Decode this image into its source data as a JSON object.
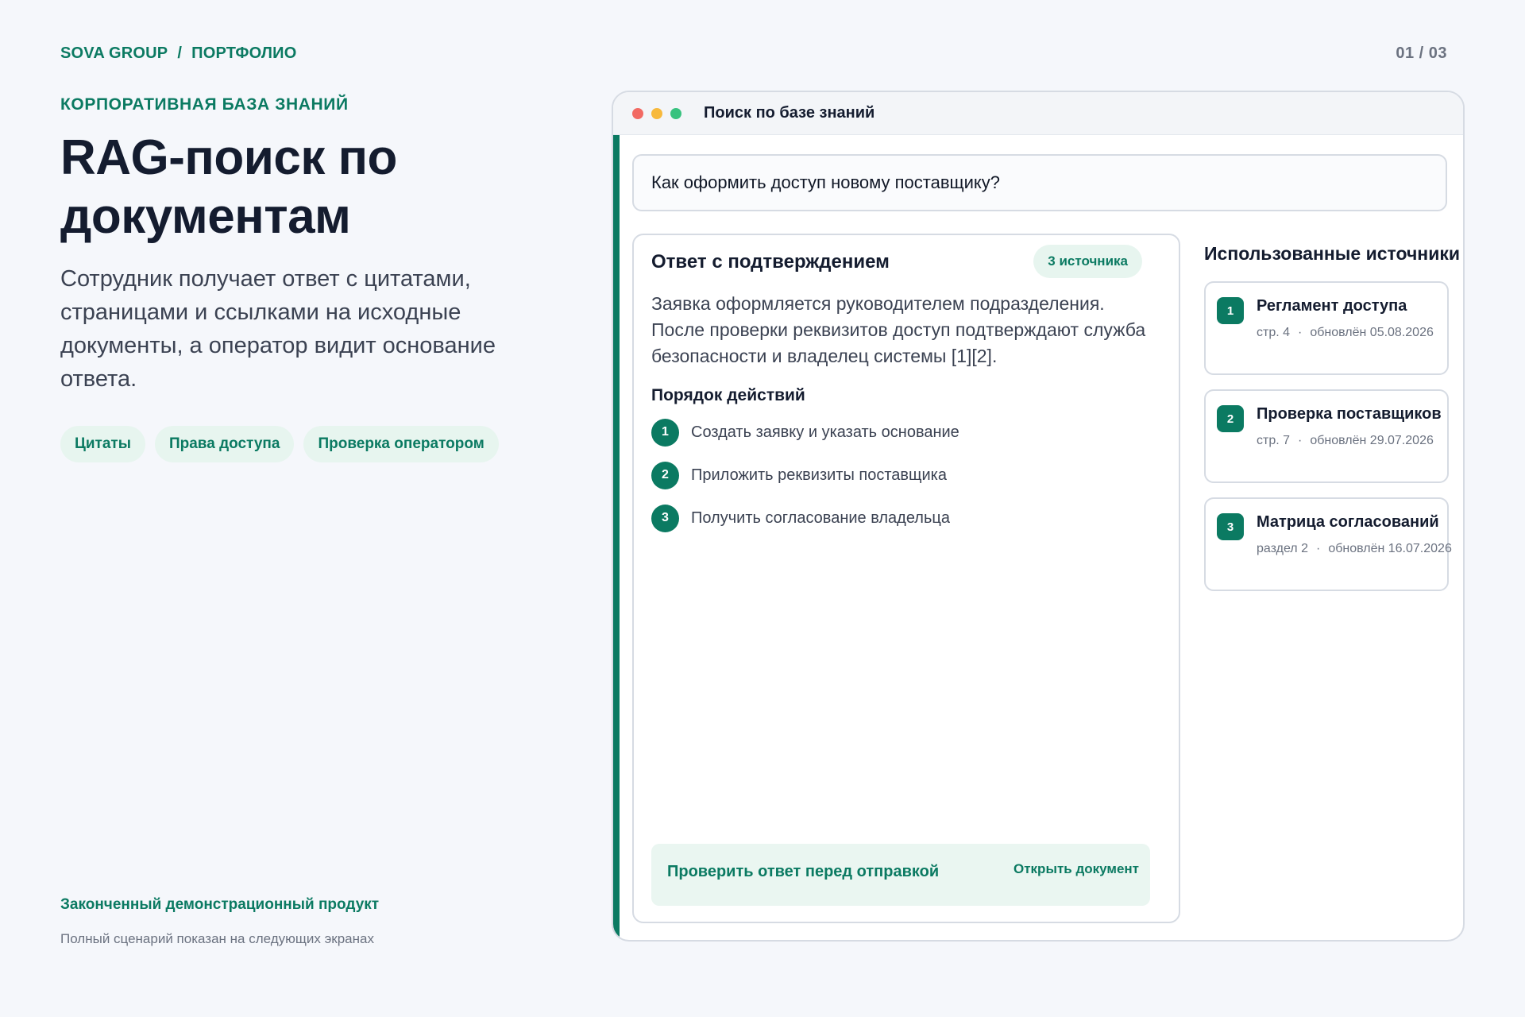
{
  "breadcrumb": {
    "company": "SOVA GROUP",
    "separator": "/",
    "section": "ПОРТФОЛИО"
  },
  "page_counter": "01 / 03",
  "hero": {
    "eyebrow": "КОРПОРАТИВНАЯ БАЗА ЗНАНИЙ",
    "title": "RAG-поиск по документам",
    "description": "Сотрудник получает ответ с цитатами, страницами и ссылками на исходные документы, а оператор видит основание ответа.",
    "tags": [
      "Цитаты",
      "Права доступа",
      "Проверка оператором"
    ]
  },
  "footer": {
    "title": "Законченный демонстрационный продукт",
    "subtitle": "Полный сценарий показан на следующих экранах"
  },
  "window": {
    "title": "Поиск по базе знаний",
    "query": "Как оформить доступ новому поставщику?",
    "answer": {
      "title": "Ответ с подтверждением",
      "badge": "3 источника",
      "text": "Заявка оформляется руководителем подразделения. После проверки реквизитов доступ подтверждают служба безопасности и владелец системы [1][2].",
      "steps_title": "Порядок действий",
      "steps": [
        {
          "num": "1",
          "text": "Создать заявку и указать основание"
        },
        {
          "num": "2",
          "text": "Приложить реквизиты поставщика"
        },
        {
          "num": "3",
          "text": "Получить согласование владельца"
        }
      ],
      "verify_label": "Проверить ответ перед отправкой",
      "open_doc_label": "Открыть документ"
    },
    "sources": {
      "title": "Использованные источники",
      "items": [
        {
          "num": "1",
          "title": "Регламент доступа",
          "location": "стр. 4",
          "updated": "обновлён 05.08.2026"
        },
        {
          "num": "2",
          "title": "Проверка поставщиков",
          "location": "стр. 7",
          "updated": "обновлён 29.07.2026"
        },
        {
          "num": "3",
          "title": "Матрица согласований",
          "location": "раздел 2",
          "updated": "обновлён 16.07.2026"
        }
      ],
      "meta_separator": "·"
    }
  },
  "colors": {
    "accent": "#0b7a62",
    "accent_light": "#e7f5ef",
    "text_dark": "#141c2f",
    "background": "#f5f7fb"
  }
}
